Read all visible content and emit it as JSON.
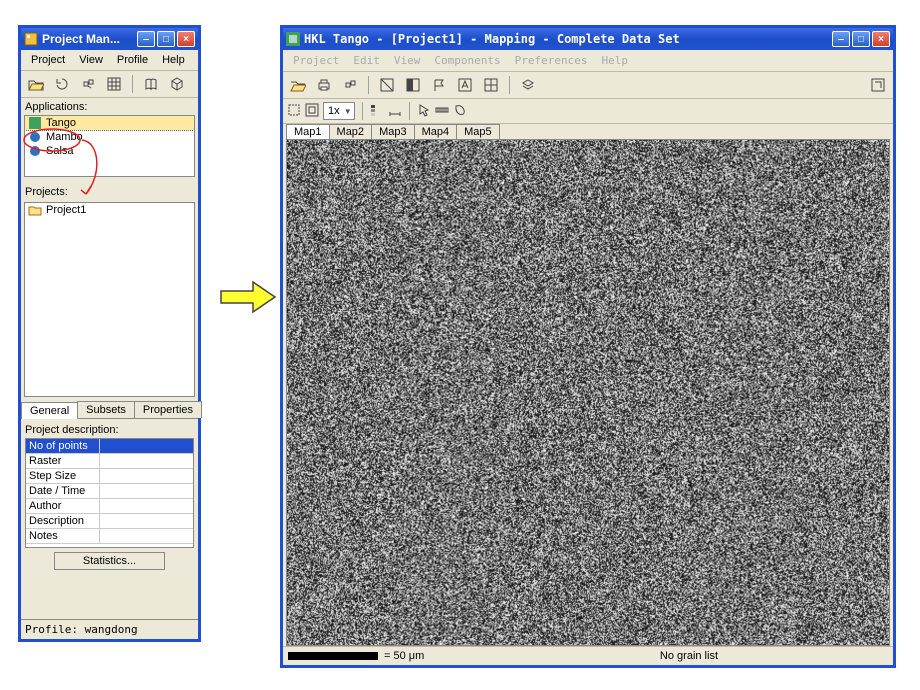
{
  "pm": {
    "title": "Project Man...",
    "menu": [
      "Project",
      "View",
      "Profile",
      "Help"
    ],
    "applications_label": "Applications:",
    "applications": [
      {
        "name": "Tango",
        "selected": true
      },
      {
        "name": "Mambo",
        "selected": false
      },
      {
        "name": "Salsa",
        "selected": false
      }
    ],
    "projects_label": "Projects:",
    "projects": [
      {
        "name": "Project1"
      }
    ],
    "tabs": [
      "General",
      "Subsets",
      "Properties"
    ],
    "tabs_active": 0,
    "desc_header": "Project description:",
    "desc_rows": [
      "No of points",
      "Raster",
      "Step Size",
      "Date / Time",
      "Author",
      "Description",
      "Notes"
    ],
    "desc_selected": 0,
    "stats_button": "Statistics...",
    "statusbar": "Profile: wangdong"
  },
  "tango": {
    "title": "HKL Tango - [Project1] - Mapping - Complete Data Set",
    "menu": [
      "Project",
      "Edit",
      "View",
      "Components",
      "Preferences",
      "Help"
    ],
    "zoom": "1x",
    "map_tabs": [
      "Map1",
      "Map2",
      "Map3",
      "Map4",
      "Map5"
    ],
    "map_tabs_active": 0,
    "scale_label": "= 50 μm",
    "grain_label": "No grain list"
  }
}
